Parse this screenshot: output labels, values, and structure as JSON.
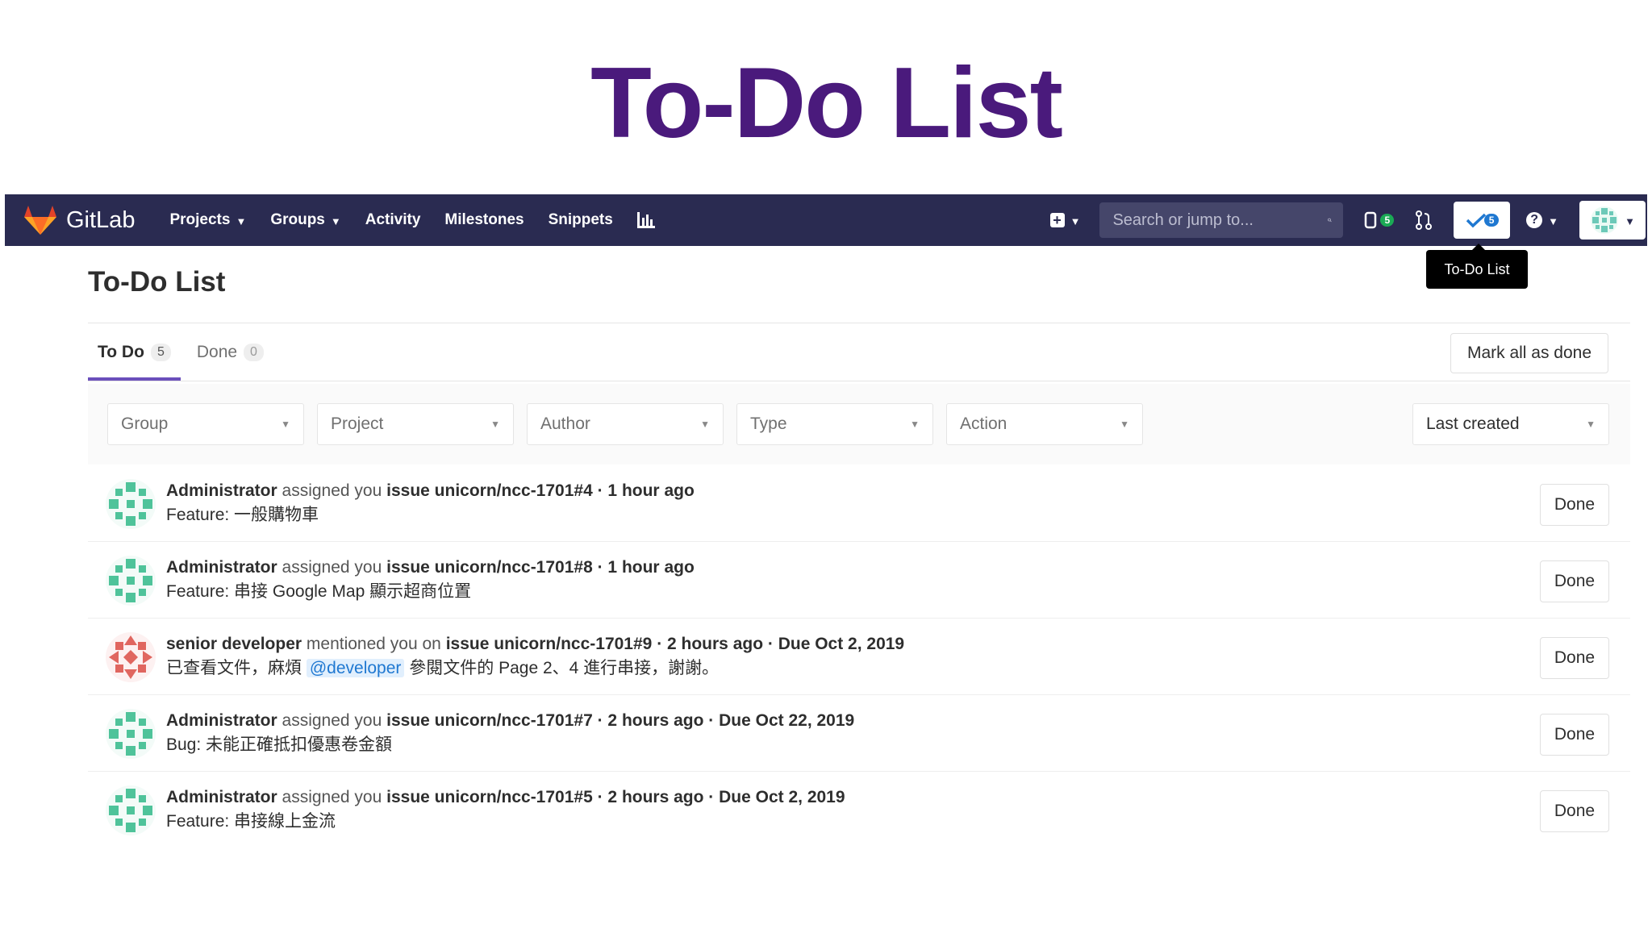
{
  "slide": {
    "title": "To-Do List"
  },
  "navbar": {
    "brand": "GitLab",
    "links": [
      {
        "label": "Projects",
        "dropdown": true
      },
      {
        "label": "Groups",
        "dropdown": true
      },
      {
        "label": "Activity",
        "dropdown": false
      },
      {
        "label": "Milestones",
        "dropdown": false
      },
      {
        "label": "Snippets",
        "dropdown": false
      }
    ],
    "search_placeholder": "Search or jump to...",
    "issues_count": "5",
    "todos_count": "5",
    "brand_color": "#2a2b51"
  },
  "tooltip": "To-Do List",
  "page": {
    "heading": "To-Do List",
    "tabs": [
      {
        "label": "To Do",
        "count": "5",
        "active": true
      },
      {
        "label": "Done",
        "count": "0",
        "active": false
      }
    ],
    "mark_all_label": "Mark all as done",
    "filters": [
      "Group",
      "Project",
      "Author",
      "Type",
      "Action"
    ],
    "sort_label": "Last created"
  },
  "todos": [
    {
      "author": "Administrator",
      "action": "assigned you",
      "target": "issue unicorn/ncc-1701#4",
      "meta": "· 1 hour ago",
      "body": "Feature: 一般購物車",
      "done_label": "Done"
    },
    {
      "author": "Administrator",
      "action": "assigned you",
      "target": "issue unicorn/ncc-1701#8",
      "meta": "· 1 hour ago",
      "body": "Feature: 串接 Google Map 顯示超商位置",
      "done_label": "Done"
    },
    {
      "author": "senior developer",
      "action": "mentioned you on",
      "target": "issue unicorn/ncc-1701#9",
      "meta": "· 2 hours ago · Due Oct 2, 2019",
      "body_before": "已查看文件，麻煩 ",
      "mention": "@developer",
      "body_after": " 參閱文件的 Page 2、4 進行串接，謝謝。",
      "done_label": "Done"
    },
    {
      "author": "Administrator",
      "action": "assigned you",
      "target": "issue unicorn/ncc-1701#7",
      "meta": "· 2 hours ago · Due Oct 22, 2019",
      "body": "Bug: 未能正確抵扣優惠卷金額",
      "done_label": "Done"
    },
    {
      "author": "Administrator",
      "action": "assigned you",
      "target": "issue unicorn/ncc-1701#5",
      "meta": "· 2 hours ago · Due Oct 2, 2019",
      "body": "Feature: 串接線上金流",
      "done_label": "Done"
    }
  ]
}
